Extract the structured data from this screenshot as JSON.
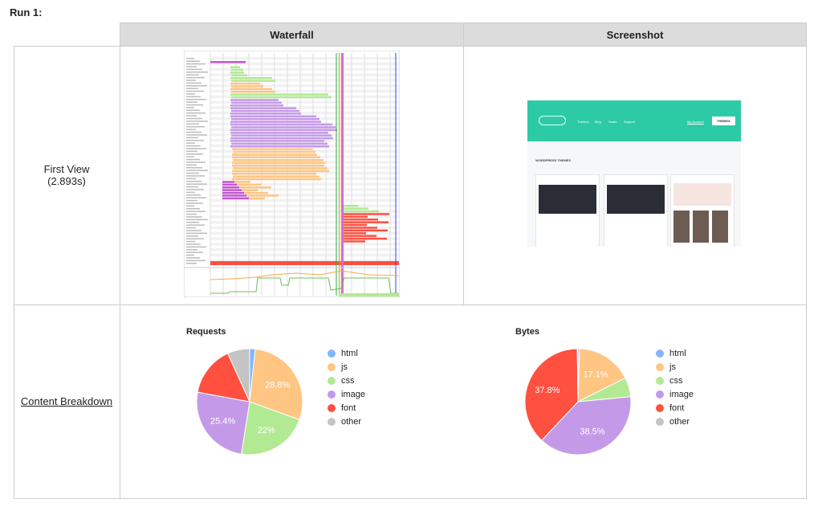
{
  "run_title": "Run 1:",
  "columns": {
    "waterfall": "Waterfall",
    "screenshot": "Screenshot"
  },
  "first_view": {
    "label": "First View",
    "time": "(2.893s)"
  },
  "content_breakdown_link": "Content Breakdown",
  "screenshot_thumb": {
    "nav": [
      "Themes",
      "Blog",
      "Deals",
      "Support"
    ],
    "account": "My Account",
    "button": "THEMES",
    "heading": "WORDPRESS THEMES",
    "brand_color": "#2ccba5"
  },
  "colors": {
    "html": "#82b6ff",
    "js": "#ffc583",
    "css": "#b2ea94",
    "image": "#c49ae8",
    "font": "#ff5040",
    "other": "#c4c4c4"
  },
  "chart_data": [
    {
      "type": "pie",
      "title": "Requests",
      "legend": "right",
      "categories": [
        "html",
        "js",
        "css",
        "image",
        "font",
        "other"
      ],
      "values": [
        1.7,
        28.8,
        22,
        25.4,
        15.3,
        6.8
      ],
      "data_labels": [
        "",
        "28.8%",
        "22%",
        "25.4%",
        "",
        ""
      ]
    },
    {
      "type": "pie",
      "title": "Bytes",
      "legend": "right",
      "categories": [
        "html",
        "js",
        "css",
        "image",
        "font",
        "other"
      ],
      "values": [
        0.5,
        17.1,
        5.9,
        38.5,
        37.8,
        0.2
      ],
      "data_labels": [
        "",
        "17.1%",
        "",
        "38.5%",
        "37.8%",
        ""
      ]
    }
  ]
}
